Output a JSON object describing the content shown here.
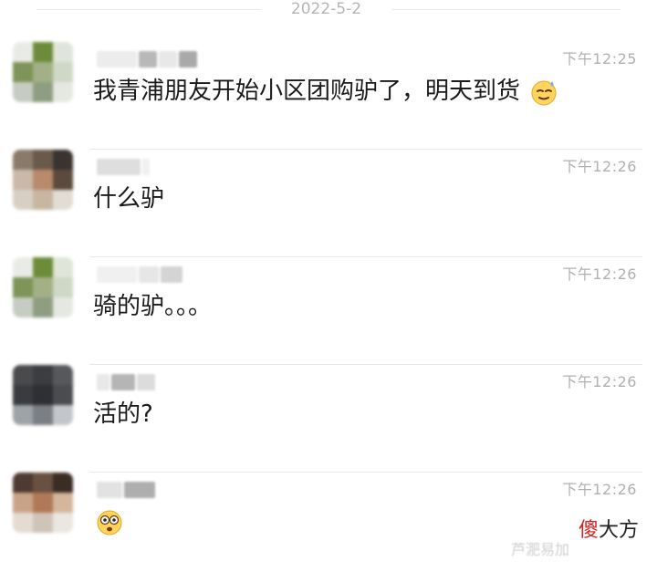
{
  "date_separator": "2022-5-2",
  "messages": [
    {
      "time": "下午12:25",
      "text": "我青浦朋友开始小区团购驴了，明天到货",
      "emoji": "sweat-smile-emoji"
    },
    {
      "time": "下午12:26",
      "text": "什么驴"
    },
    {
      "time": "下午12:26",
      "text": "骑的驴。。。"
    },
    {
      "time": "下午12:26",
      "text": "活的?"
    },
    {
      "time": "下午12:26",
      "text": "",
      "emoji": "shocked-face-emoji"
    }
  ],
  "watermark": {
    "brand_part1": "傻",
    "brand_part2": "大方",
    "gray_text": "芦淝易加"
  },
  "colors": {
    "background": "#ffffff",
    "text": "#1a1a1a",
    "time": "#b0b0b0",
    "divider": "#e8e8e8",
    "brand_red": "#d42020"
  }
}
